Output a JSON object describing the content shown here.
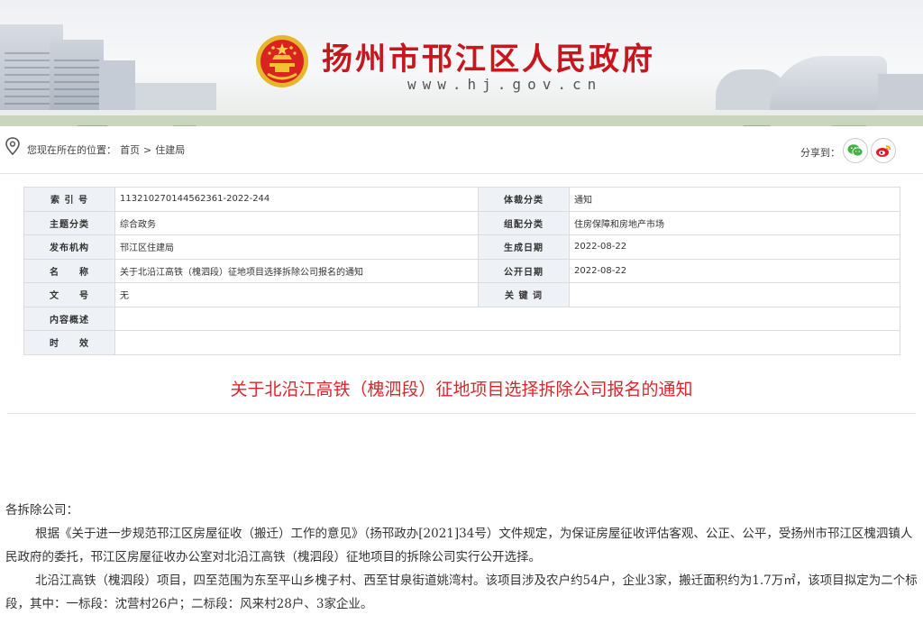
{
  "header": {
    "site_title": "扬州市邗江区人民政府",
    "site_url": "www.hj.gov.cn",
    "brand_color": "#c8161d"
  },
  "breadcrumb": {
    "label": "您现在所在的位置：",
    "items": [
      "首页",
      ">",
      "住建局"
    ]
  },
  "share": {
    "label": "分享到：",
    "wechat_icon": "wechat-icon",
    "weibo_icon": "weibo-icon"
  },
  "meta": {
    "index_no_label": "索 引 号",
    "index_no": "113210270144562361-2022-244",
    "genre_label": "体裁分类",
    "genre": "通知",
    "topic_label": "主题分类",
    "topic": "综合政务",
    "org_cat_label": "组配分类",
    "org_cat": "住房保障和房地产市场",
    "publisher_label": "发布机构",
    "publisher": "邗江区住建局",
    "gen_date_label": "生成日期",
    "gen_date": "2022-08-22",
    "name_label": "名　　称",
    "name": "关于北沿江高铁（槐泗段）征地项目选择拆除公司报名的通知",
    "pub_date_label": "公开日期",
    "pub_date": "2022-08-22",
    "doc_no_label": "文　　号",
    "doc_no": "无",
    "keywords_label": "关 键 词",
    "keywords": "",
    "summary_label": "内容概述",
    "summary": "",
    "validity_label": "时　　效",
    "validity": ""
  },
  "article": {
    "title": "关于北沿江高铁（槐泗段）征地项目选择拆除公司报名的通知",
    "title_color": "#d9272e",
    "salutation": "各拆除公司：",
    "paragraph_1": "根据《关于进一步规范邗江区房屋征收（搬迁）工作的意见》（扬邗政办[2021]34号）文件规定，为保证房屋征收评估客观、公正、公平，受扬州市邗江区槐泗镇人民政府的委托，邗江区房屋征收办公室对北沿江高铁（槐泗段）征地项目的拆除公司实行公开选择。",
    "paragraph_2": "北沿江高铁（槐泗段）项目，四至范围为东至平山乡槐子村、西至甘泉街道姚湾村。该项目涉及农户约54户，企业3家，搬迁面积约为1.7万㎡，该项目拟定为二个标段，其中：一标段：沈营村26户；二标段：风来村28户、3家企业。"
  }
}
